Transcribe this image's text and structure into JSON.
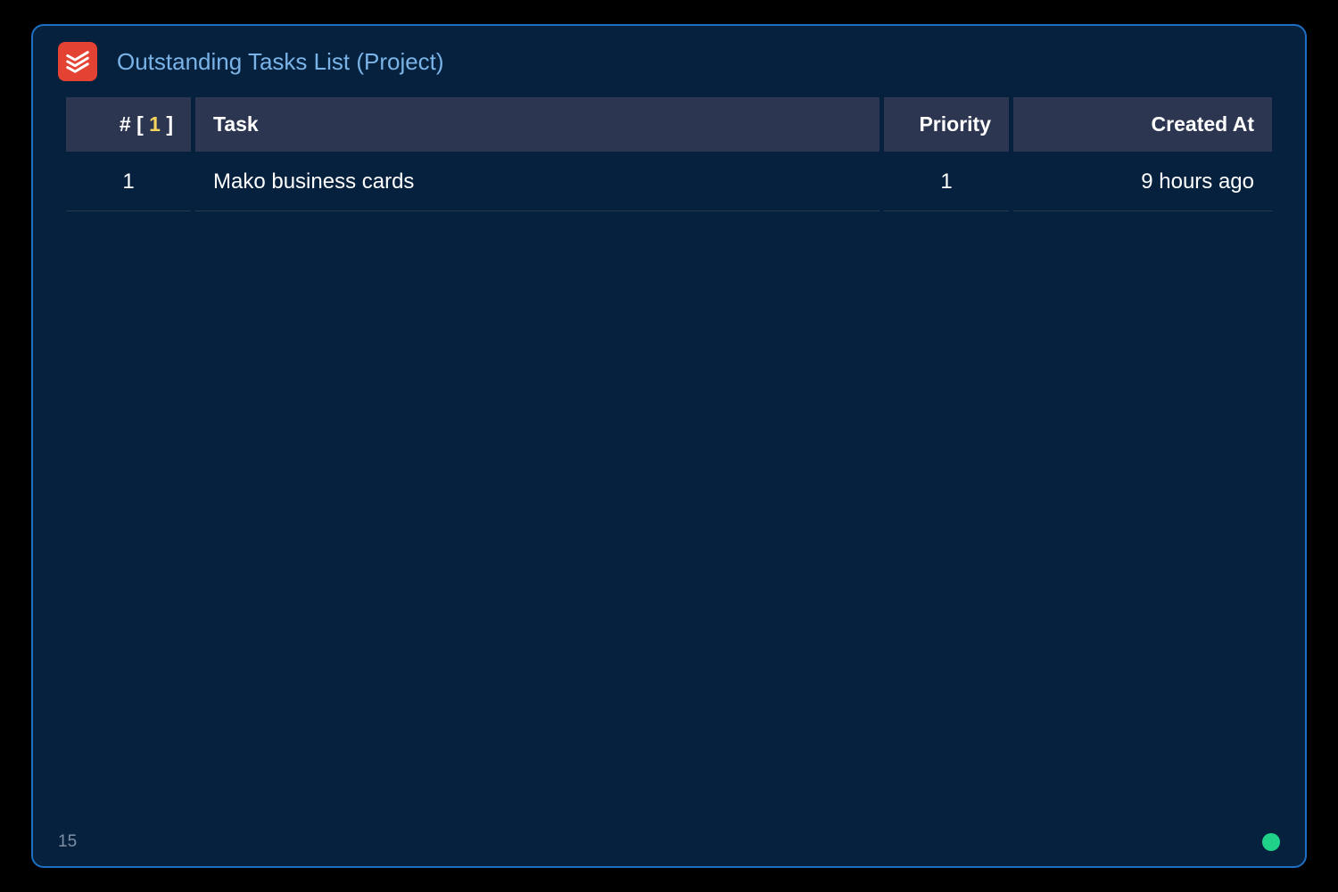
{
  "panel": {
    "title": "Outstanding Tasks List (Project)",
    "icon": "todoist-icon"
  },
  "table": {
    "headers": {
      "index_prefix": "# [ ",
      "index_count": "1",
      "index_suffix": " ]",
      "task": "Task",
      "priority": "Priority",
      "created": "Created At"
    },
    "rows": [
      {
        "index": "1",
        "task": "Mako business cards",
        "priority": "1",
        "created": "9 hours ago"
      }
    ]
  },
  "footer": {
    "counter": "15"
  },
  "colors": {
    "panel_bg": "#05213e",
    "panel_border": "#1d6fc4",
    "header_label": "#7ab3e7",
    "th_bg": "#2c3650",
    "count_accent": "#f4d35e",
    "status_dot": "#20d18a",
    "app_icon_bg": "#e44232"
  }
}
